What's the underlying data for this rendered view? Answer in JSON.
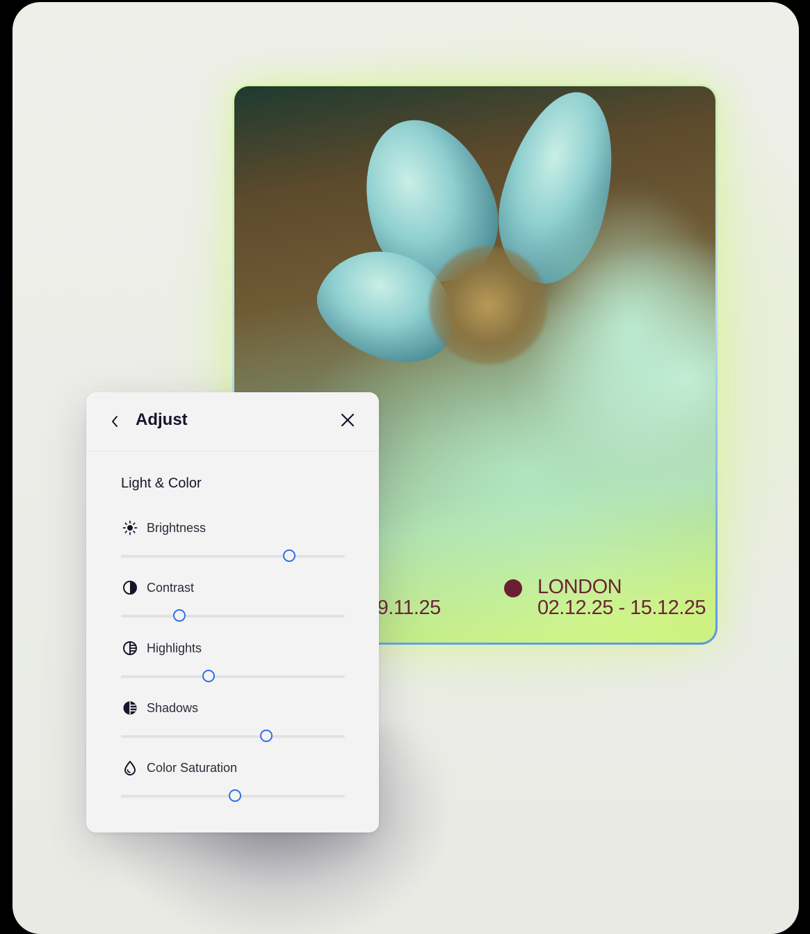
{
  "panel": {
    "title": "Adjust",
    "section_title": "Light & Color",
    "controls": [
      {
        "label": "Brightness",
        "icon": "sun-icon",
        "value": 0.75
      },
      {
        "label": "Contrast",
        "icon": "contrast-icon",
        "value": 0.26
      },
      {
        "label": "Highlights",
        "icon": "highlights-icon",
        "value": 0.39
      },
      {
        "label": "Shadows",
        "icon": "shadows-icon",
        "value": 0.65
      },
      {
        "label": "Color Saturation",
        "icon": "droplet-icon",
        "value": 0.51
      }
    ],
    "accent_color": "#2f6fe8"
  },
  "poster": {
    "left_event_dates": "29.11.25",
    "right_event_city": "LONDON",
    "right_event_dates": "02.12.25 - 15.12.25",
    "text_color": "#6b2435"
  }
}
